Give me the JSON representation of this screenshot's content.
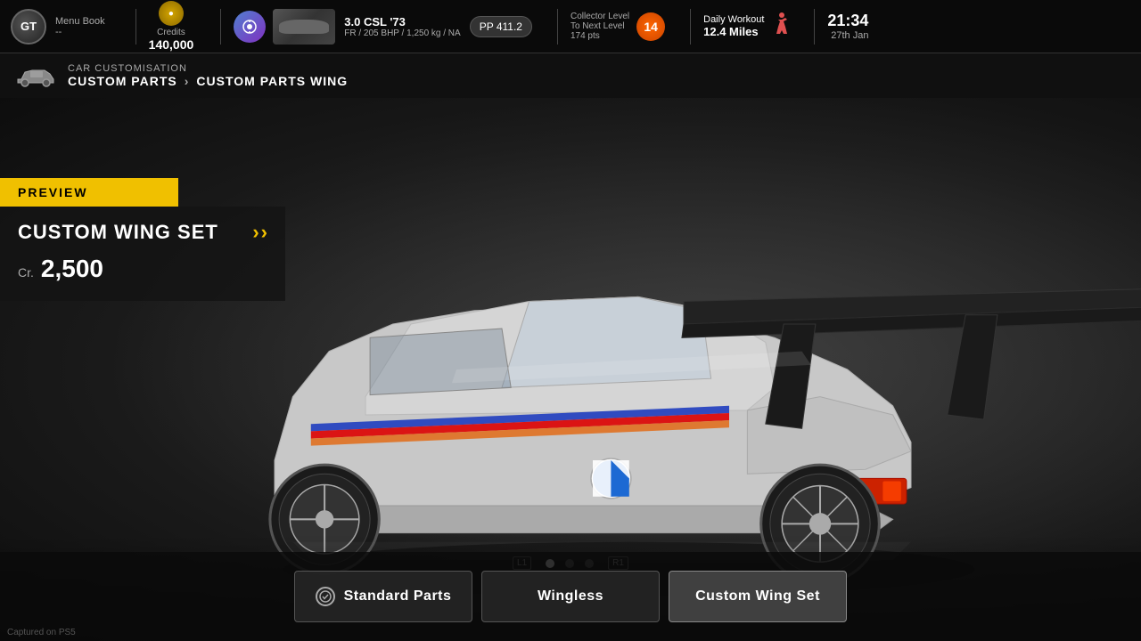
{
  "header": {
    "logo": "GT",
    "menu_book": "Menu Book",
    "menu_book_sub": "--",
    "credits_label": "Credits",
    "credits_amount": "140,000",
    "car_name": "3.0 CSL '73",
    "car_specs": "FR / 205 BHP / 1,250 kg / NA",
    "pp_value": "PP 411.2",
    "collector_label": "Collector Level",
    "collector_sublevel": "To Next Level",
    "collector_pts": "174 pts",
    "collector_level": "14",
    "workout_label": "Daily Workout",
    "workout_miles": "12.4 Miles",
    "time": "21:34",
    "date": "27th Jan"
  },
  "breadcrumb": {
    "section": "CAR CUSTOMISATION",
    "parent": "CUSTOM PARTS",
    "current": "CUSTOM PARTS WING"
  },
  "preview": {
    "label": "PREVIEW",
    "item_name": "CUSTOM WING SET",
    "price_label": "Cr.",
    "price_amount": "2,500"
  },
  "dots": {
    "total": 3,
    "active": 0,
    "left_trigger": "L1",
    "right_trigger": "R1"
  },
  "buttons": [
    {
      "id": "standard",
      "label": "Standard Parts",
      "has_check": true,
      "active": false
    },
    {
      "id": "wingless",
      "label": "Wingless",
      "has_check": false,
      "active": false
    },
    {
      "id": "custom",
      "label": "Custom Wing Set",
      "has_check": false,
      "active": true
    }
  ],
  "captured": "Captured on PS5",
  "colors": {
    "accent_yellow": "#f0c000",
    "preview_bg": "rgba(20,20,20,0.85)",
    "active_button_bg": "rgba(70,70,70,0.9)"
  }
}
